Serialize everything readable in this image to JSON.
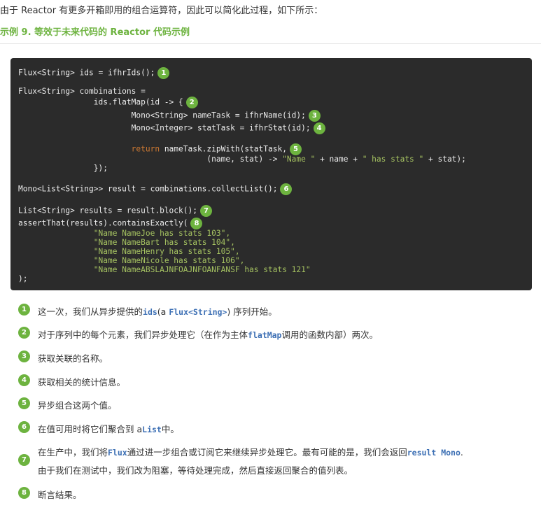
{
  "intro": {
    "text": "由于 Reactor 有更多开箱即用的组合运算符，因此可以简化此过程，如下所示："
  },
  "example": {
    "title": "示例 9. 等效于未来代码的 Reactor 代码示例"
  },
  "code": {
    "line1": "Flux<String> ids = ifhrIds();",
    "line2": "Flux<String> combinations =",
    "line3": "                ids.flatMap(id -> {",
    "line4": "                        Mono<String> nameTask = ifhrName(id);",
    "line5": "                        Mono<Integer> statTask = ifhrStat(id);",
    "line6_indent": "                        ",
    "line6_kw": "return",
    "line6_rest": " nameTask.zipWith(statTask,",
    "line7_pre": "                                        (name, stat) -> ",
    "line7_s1": "\"Name \"",
    "line7_mid": " + name + ",
    "line7_s2": "\" has stats \"",
    "line7_post": " + stat);",
    "line8": "                });",
    "line9": "Mono<List<String>> result = combinations.collectList();",
    "line10": "List<String> results = result.block();",
    "line11": "assertThat(results).containsExactly(",
    "line12_indent": "                ",
    "line12": "\"Name NameJoe has stats 103\",",
    "line13": "\"Name NameBart has stats 104\",",
    "line14": "\"Name NameHenry has stats 105\",",
    "line15": "\"Name NameNicole has stats 106\",",
    "line16": "\"Name NameABSLAJNFOAJNFOANFANSF has stats 121\"",
    "line17": ");"
  },
  "badges": [
    "1",
    "2",
    "3",
    "4",
    "5",
    "6",
    "7",
    "8"
  ],
  "callouts": {
    "c1": {
      "a": "这一次，我们从异步提供的",
      "code1": "ids",
      "b": "(a ",
      "code2": "Flux<String>",
      "c": ") 序列开始。"
    },
    "c2": {
      "a": "对于序列中的每个元素，我们异步处理它（在作为主体",
      "code1": "flatMap",
      "b": "调用的函数内部）两次。"
    },
    "c3": {
      "a": "获取关联的名称。"
    },
    "c4": {
      "a": "获取相关的统计信息。"
    },
    "c5": {
      "a": "异步组合这两个值。"
    },
    "c6": {
      "a": "在值可用时将它们聚合到 a",
      "code1": "List",
      "b": "中。"
    },
    "c7": {
      "a": "在生产中，我们将",
      "code1": "Flux",
      "b": "通过进一步组合或订阅它来继续异步处理它。最有可能的是，我们会返回",
      "code2": "result Mono",
      "c": ".",
      "d": "由于我们在测试中，我们改为阻塞，等待处理完成，然后直接返回聚合的值列表。"
    },
    "c8": {
      "a": "断言结果。"
    }
  },
  "colors": {
    "accent": "#6db33f",
    "code_bg": "#2b2b2b",
    "keyword": "#cc7832",
    "string": "#a5c261",
    "inline_code": "#3c6fb4"
  }
}
